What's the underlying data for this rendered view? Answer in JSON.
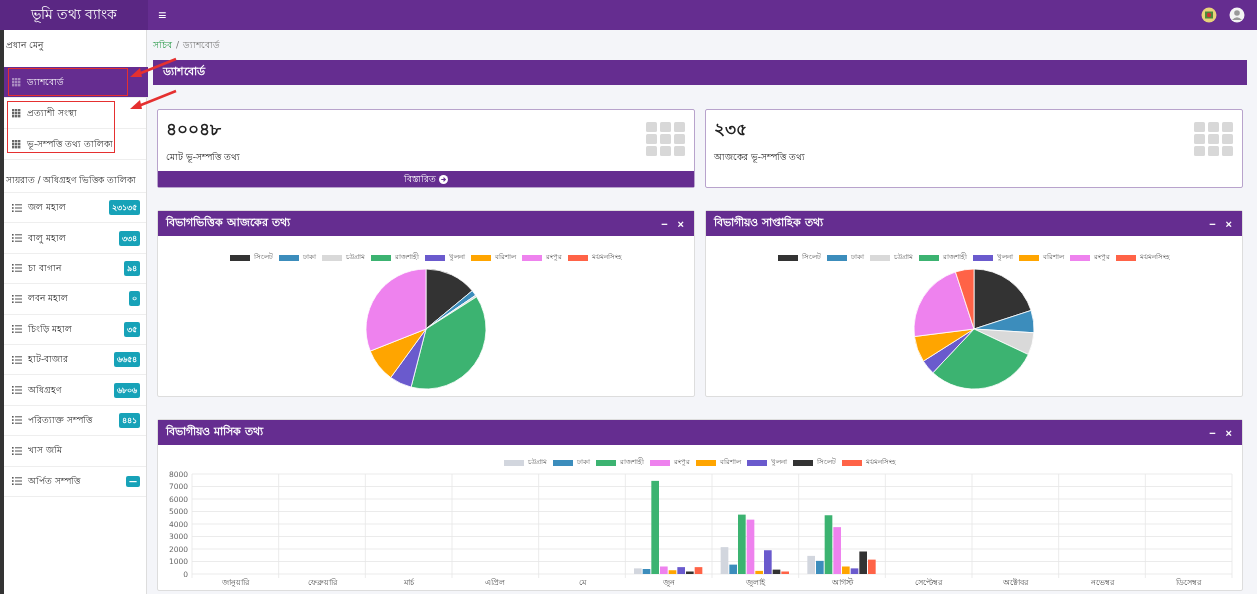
{
  "header": {
    "title": "ভূমি তথ্য ব্যাংক",
    "menu_toggle": "≡"
  },
  "sidebar": {
    "main_heading": "প্রধান মেনু",
    "main_items": [
      {
        "label": "ড্যাশবোর্ড",
        "selected": true
      },
      {
        "label": "প্রত্যাশী সংস্থা",
        "selected": false
      },
      {
        "label": "ভূ-সম্পত্তি তথ্য তালিকা",
        "selected": false
      }
    ],
    "list_heading": "সায়রাত / অধিগ্রহণ ভিত্তিক তালিকা",
    "list_items": [
      {
        "label": "জল মহাল",
        "badge": "২৩১৩৫"
      },
      {
        "label": "বালু মহাল",
        "badge": "৩৩৪"
      },
      {
        "label": "চা বাগান",
        "badge": "৯৪"
      },
      {
        "label": "লবন মহাল",
        "badge": "০"
      },
      {
        "label": "চিংড়ি মহাল",
        "badge": "৩৫"
      },
      {
        "label": "হাট-বাজার",
        "badge": "৬৬৫৪"
      },
      {
        "label": "অধিগ্রহণ",
        "badge": "৬৮০৬"
      },
      {
        "label": "পরিত্যাক্ত সম্পত্তি",
        "badge": "৪৪১"
      },
      {
        "label": "খাস জমি"
      },
      {
        "label": "অর্পিত সম্পত্তি",
        "badge": "—"
      }
    ]
  },
  "breadcrumb": {
    "link": "সচিব",
    "separator": "/",
    "current": "ড্যাশবোর্ড"
  },
  "page_title": "ড্যাশবোর্ড",
  "stat_cards": [
    {
      "value": "৪০০৪৮",
      "label": "মোট ভূ-সম্পত্তি তথ্য",
      "footer": "বিস্তারিত"
    },
    {
      "value": "২৩৫",
      "label": "আজকের ভূ-সম্পত্তি তথ্য"
    }
  ],
  "pie_panels": [
    {
      "title": "বিভাগভিত্তিক আজকের তথ্য",
      "minimize": "−",
      "close": "×",
      "legend": [
        {
          "name": "সিলেট",
          "color": "#333333"
        },
        {
          "name": "ঢাকা",
          "color": "#3c8dbc"
        },
        {
          "name": "চট্টগ্রাম",
          "color": "#d9d9d9"
        },
        {
          "name": "রাজশাহী",
          "color": "#3cb371"
        },
        {
          "name": "খুলনা",
          "color": "#6a5acd"
        },
        {
          "name": "বরিশাল",
          "color": "#ffa500"
        },
        {
          "name": "রংপুর",
          "color": "#ee82ee"
        },
        {
          "name": "ময়মনসিংহ",
          "color": "#ff6347"
        }
      ]
    },
    {
      "title": "বিভাগীয়ও সাপ্তাহিক তথ্য",
      "minimize": "−",
      "close": "×",
      "legend": [
        {
          "name": "সিলেট",
          "color": "#333333"
        },
        {
          "name": "ঢাকা",
          "color": "#3c8dbc"
        },
        {
          "name": "চট্টগ্রাম",
          "color": "#d9d9d9"
        },
        {
          "name": "রাজশাহী",
          "color": "#3cb371"
        },
        {
          "name": "খুলনা",
          "color": "#6a5acd"
        },
        {
          "name": "বরিশাল",
          "color": "#ffa500"
        },
        {
          "name": "রংপুর",
          "color": "#ee82ee"
        },
        {
          "name": "ময়মনসিংহ",
          "color": "#ff6347"
        }
      ]
    }
  ],
  "bar_panel": {
    "title": "বিভাগীয়ও মাসিক তথ্য",
    "minimize": "−",
    "close": "×",
    "chart_data": {
      "type": "bar",
      "grid": true,
      "legend": "top",
      "categories": [
        "জানুয়ারি",
        "ফেব্রুয়ারি",
        "মার্চ",
        "এপ্রিল",
        "মে",
        "জুন",
        "জুলাই",
        "আগস্ট",
        "সেপ্টেম্বর",
        "অক্টোবর",
        "নভেম্বর",
        "ডিসেম্বর"
      ],
      "ylim": [
        0,
        8000
      ],
      "yticks": [
        0,
        1000,
        2000,
        3000,
        4000,
        5000,
        6000,
        7000,
        8000
      ],
      "series": [
        {
          "name": "চট্টগ্রাম",
          "color": "#d2d6de",
          "values": [
            0,
            0,
            0,
            0,
            0,
            450,
            2150,
            1450,
            0,
            0,
            0,
            0
          ]
        },
        {
          "name": "ঢাকা",
          "color": "#3c8dbc",
          "values": [
            0,
            0,
            0,
            0,
            0,
            400,
            750,
            1050,
            0,
            0,
            0,
            0
          ]
        },
        {
          "name": "রাজশাহী",
          "color": "#3cb371",
          "values": [
            0,
            0,
            0,
            0,
            0,
            7450,
            4750,
            4700,
            0,
            0,
            0,
            0
          ]
        },
        {
          "name": "রংপুর",
          "color": "#ee82ee",
          "values": [
            0,
            0,
            0,
            0,
            0,
            600,
            4350,
            3750,
            0,
            0,
            0,
            0
          ]
        },
        {
          "name": "বরিশাল",
          "color": "#ffa500",
          "values": [
            0,
            0,
            0,
            0,
            0,
            300,
            250,
            600,
            0,
            0,
            0,
            0
          ]
        },
        {
          "name": "খুলনা",
          "color": "#6a5acd",
          "values": [
            0,
            0,
            0,
            0,
            0,
            550,
            1900,
            450,
            0,
            0,
            0,
            0
          ]
        },
        {
          "name": "সিলেট",
          "color": "#333333",
          "values": [
            0,
            0,
            0,
            0,
            0,
            200,
            350,
            1800,
            0,
            0,
            0,
            0
          ]
        },
        {
          "name": "ময়মনসিংহ",
          "color": "#ff6347",
          "values": [
            0,
            0,
            0,
            0,
            0,
            550,
            200,
            1150,
            0,
            0,
            0,
            0
          ]
        }
      ]
    }
  }
}
